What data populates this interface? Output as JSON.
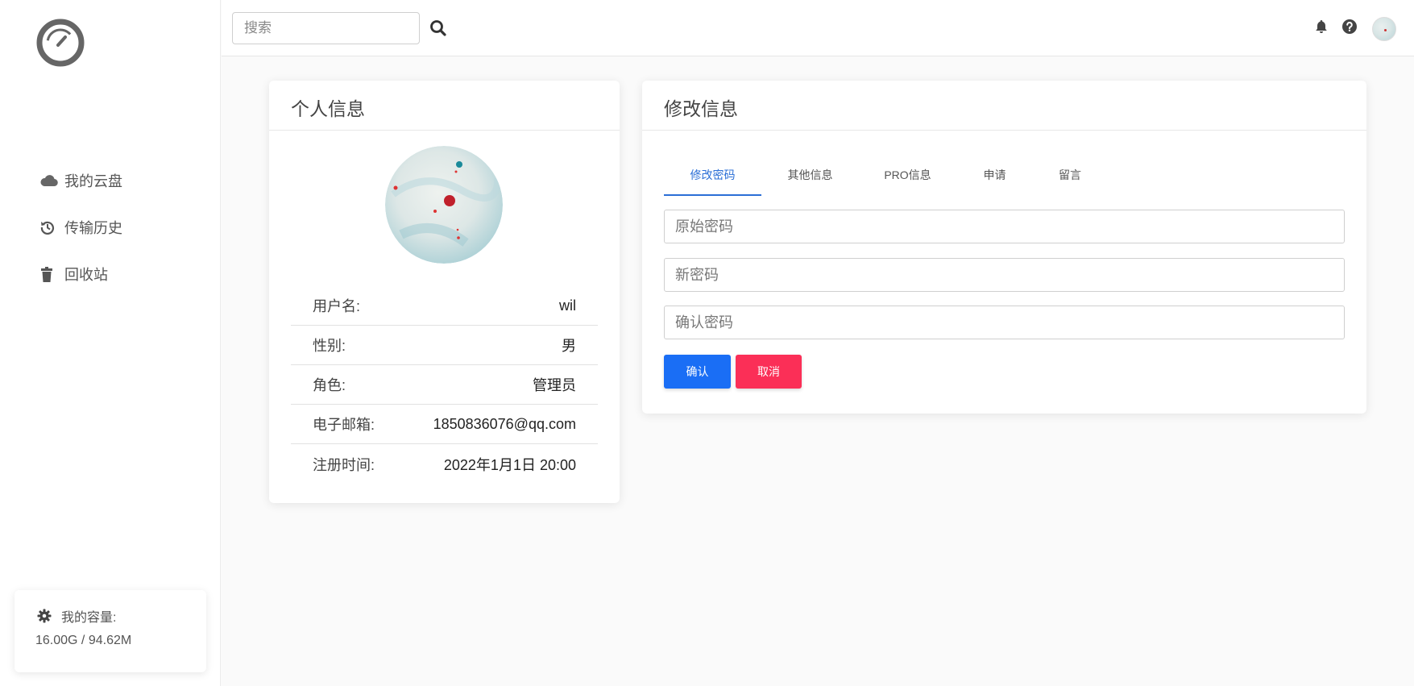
{
  "sidebar": {
    "logo": "speedometer-logo",
    "items": [
      {
        "label": "我的云盘",
        "icon": "cloud-icon"
      },
      {
        "label": "传输历史",
        "icon": "history-icon"
      },
      {
        "label": "回收站",
        "icon": "trash-icon"
      }
    ],
    "capacity": {
      "label": "我的容量:",
      "value": "16.00G / 94.62M",
      "icon": "gear-icon"
    }
  },
  "header": {
    "search_placeholder": "搜索",
    "icons": [
      "search-icon",
      "bell-icon",
      "help-icon",
      "avatar"
    ]
  },
  "profile": {
    "title": "个人信息",
    "rows": [
      {
        "key": "用户名:",
        "value": "wil"
      },
      {
        "key": "性别:",
        "value": "男"
      },
      {
        "key": "角色:",
        "value": "管理员"
      },
      {
        "key": "电子邮箱:",
        "value": "1850836076@qq.com"
      },
      {
        "key": "注册时间:",
        "value": "2022年1月1日 20:00"
      }
    ]
  },
  "edit": {
    "title": "修改信息",
    "tabs": [
      "修改密码",
      "其他信息",
      "PRO信息",
      "申请",
      "留言"
    ],
    "active_tab": 0,
    "fields": [
      {
        "placeholder": "原始密码",
        "value": ""
      },
      {
        "placeholder": "新密码",
        "value": ""
      },
      {
        "placeholder": "确认密码",
        "value": ""
      }
    ],
    "confirm_label": "确认",
    "cancel_label": "取消"
  },
  "colors": {
    "primary": "#1a6ef5",
    "danger": "#fb2f57",
    "tab_active": "#2b6fd6"
  }
}
